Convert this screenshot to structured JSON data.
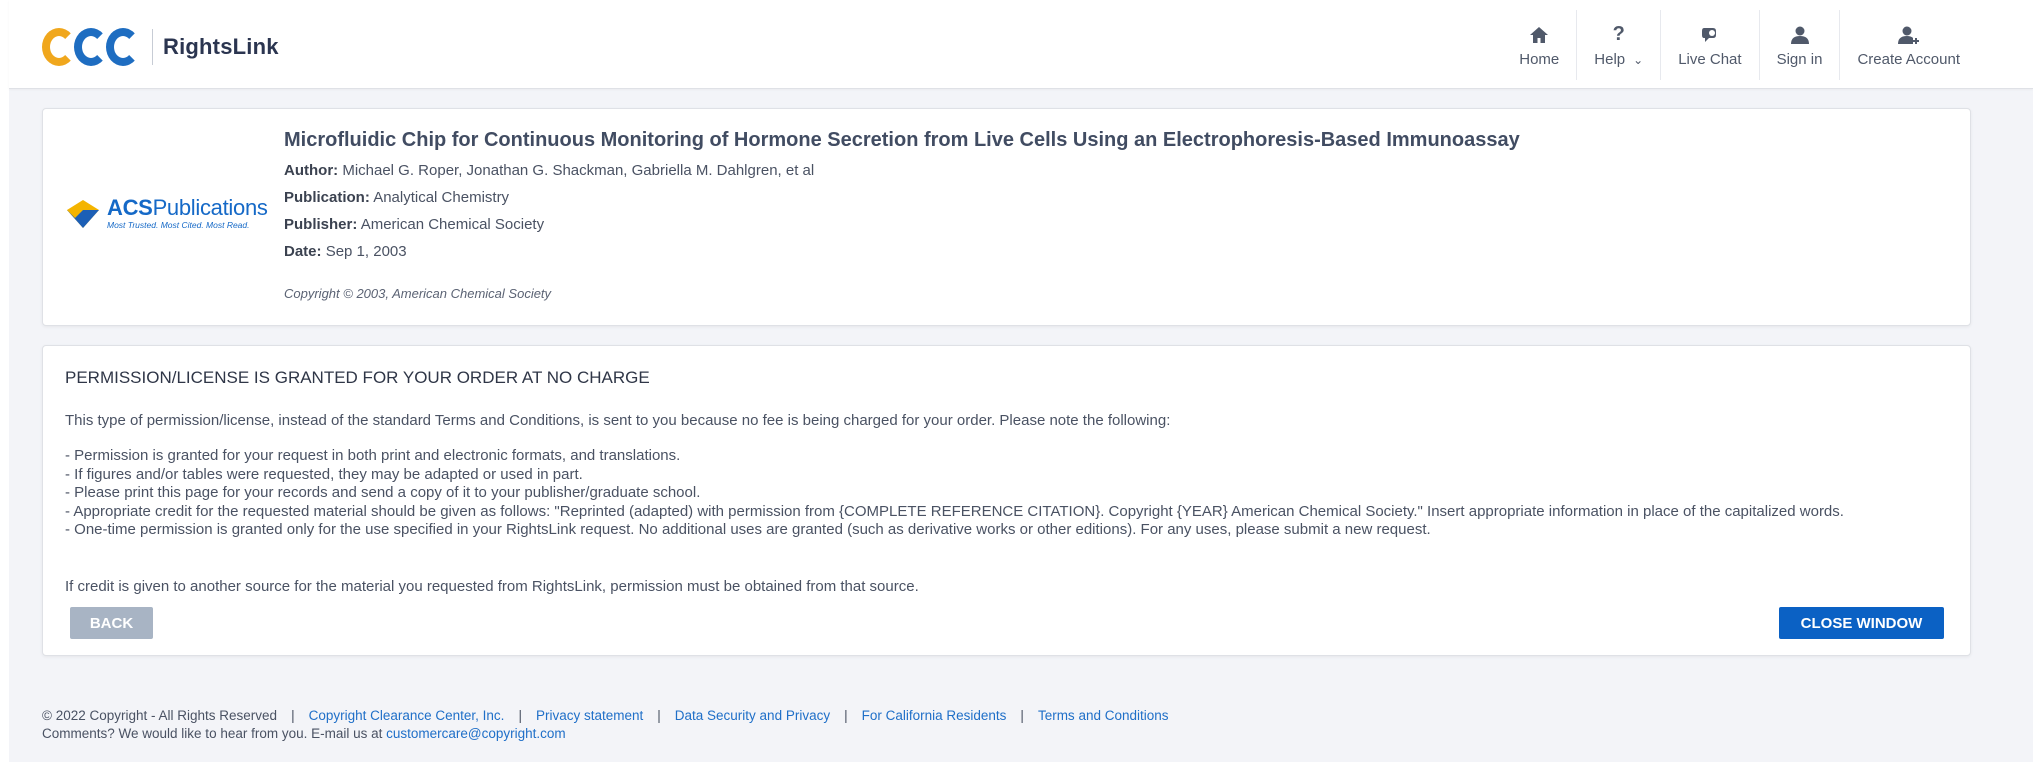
{
  "brand": {
    "logo_text": "CCC",
    "product": "RightsLink"
  },
  "nav": {
    "home": {
      "label": "Home",
      "icon": "home-icon"
    },
    "help": {
      "label": "Help",
      "icon": "question-icon"
    },
    "live_chat": {
      "label": "Live Chat",
      "icon": "chat-icon"
    },
    "sign_in": {
      "label": "Sign in",
      "icon": "user-icon"
    },
    "create_account": {
      "label": "Create Account",
      "icon": "user-add-icon"
    }
  },
  "publisher_logo": {
    "name": "ACS Publications",
    "word1": "ACS",
    "word2": "Publications",
    "tagline": "Most Trusted. Most Cited. Most Read."
  },
  "article": {
    "title": "Microfluidic Chip for Continuous Monitoring of Hormone Secretion from Live Cells Using an Electrophoresis-Based Immunoassay",
    "author_label": "Author:",
    "author": "Michael G. Roper, Jonathan G. Shackman, Gabriella M. Dahlgren, et al",
    "publication_label": "Publication:",
    "publication": "Analytical Chemistry",
    "publisher_label": "Publisher:",
    "publisher": "American Chemical Society",
    "date_label": "Date:",
    "date": "Sep 1, 2003",
    "copyright": "Copyright © 2003, American Chemical Society"
  },
  "permission": {
    "heading": "PERMISSION/LICENSE IS GRANTED FOR YOUR ORDER AT NO CHARGE",
    "lead": "This type of permission/license, instead of the standard Terms and Conditions, is sent to you because no fee is being charged for your order. Please note the following:",
    "bullets": [
      "- Permission is granted for your request in both print and electronic formats, and translations.",
      "- If figures and/or tables were requested, they may be adapted or used in part.",
      "- Please print this page for your records and send a copy of it to your publisher/graduate school.",
      "- Appropriate credit for the requested material should be given as follows: \"Reprinted (adapted) with permission from {COMPLETE REFERENCE CITATION}. Copyright {YEAR} American Chemical Society.\" Insert appropriate information in place of the capitalized words.",
      "- One-time permission is granted only for the use specified in your RightsLink request. No additional uses are granted (such as derivative works or other editions). For any uses, please submit a new request."
    ],
    "credit_note": "If credit is given to another source for the material you requested from RightsLink, permission must be obtained from that source.",
    "back_label": "BACK",
    "close_label": "CLOSE WINDOW"
  },
  "footer": {
    "copyright": "© 2022 Copyright - All Rights Reserved",
    "links": [
      "Copyright Clearance Center, Inc.",
      "Privacy statement",
      "Data Security and Privacy",
      "For California Residents",
      "Terms and Conditions"
    ],
    "comments": "Comments? We would like to hear from you. E-mail us at",
    "email": "customercare@copyright.com"
  },
  "colors": {
    "primary": "#0b61c4",
    "back_button": "#a8b4c4",
    "link": "#1f6fc8",
    "ccc_orange": "#f0a71d",
    "ccc_blue": "#1e6dc1"
  }
}
